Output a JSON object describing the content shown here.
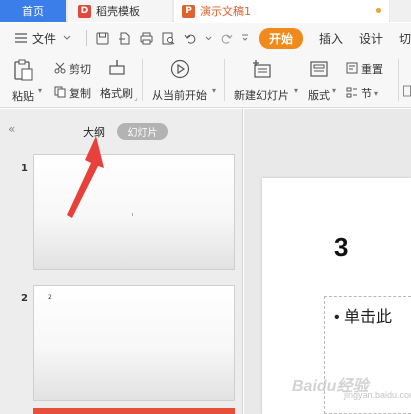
{
  "tabbar": {
    "home_label": "首页",
    "template_label": "稻壳模板",
    "doc_label": "演示文稿1"
  },
  "menu": {
    "file_label": "文件",
    "start_label": "开始",
    "insert_label": "插入",
    "design_label": "设计",
    "cut_partial_label": "切"
  },
  "ribbon": {
    "paste_label": "粘贴",
    "cut_label": "剪切",
    "copy_label": "复制",
    "format_painter_label": "格式刷",
    "from_current_label": "从当前开始",
    "new_slide_label": "新建幻灯片",
    "layout_label": "版式",
    "reset_label": "重置",
    "section_label": "节"
  },
  "left_panel": {
    "collapse_glyph": "«",
    "outline_tab_label": "大纲",
    "slides_tab_label": "幻灯片",
    "slides": [
      {
        "number": "1"
      },
      {
        "number": "2",
        "preview_text": "2"
      }
    ]
  },
  "slide_canvas": {
    "title_text": "3",
    "bullet_text": "• 单击此"
  },
  "watermark": {
    "main": "Baidu经验",
    "sub": "jingyan.baidu.com"
  },
  "colors": {
    "home_tab": "#3b7de9",
    "start_button": "#f08a1a",
    "annotation_arrow": "#e8403a"
  }
}
